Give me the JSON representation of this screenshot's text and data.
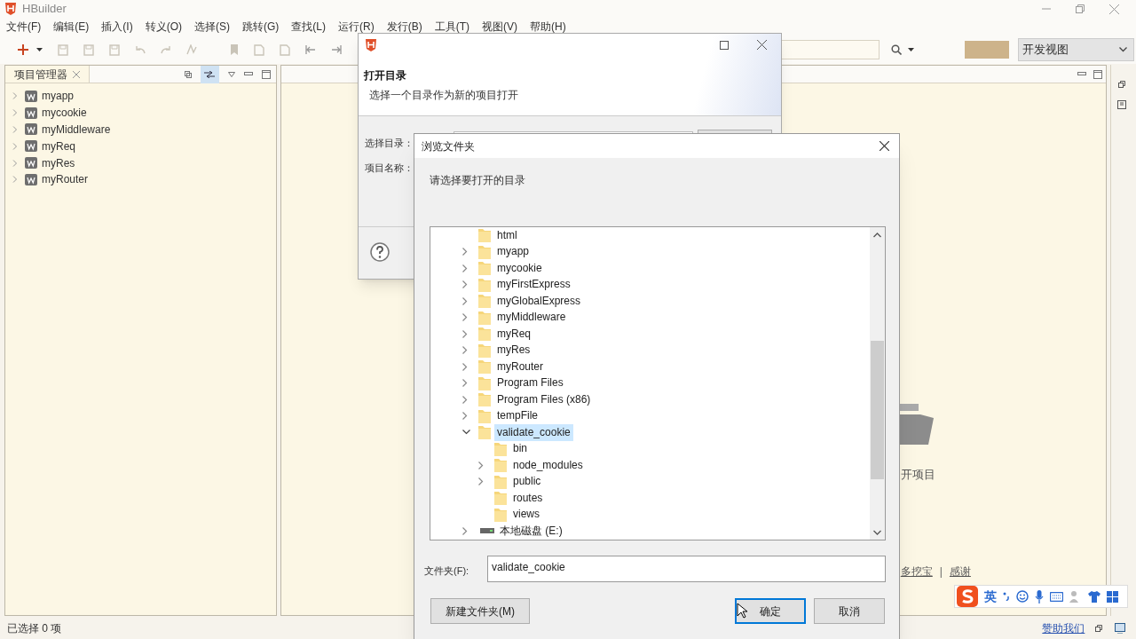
{
  "app": {
    "title": "HBuilder"
  },
  "menu": [
    "文件(F)",
    "编辑(E)",
    "插入(I)",
    "转义(O)",
    "选择(S)",
    "跳转(G)",
    "查找(L)",
    "运行(R)",
    "发行(B)",
    "工具(T)",
    "视图(V)",
    "帮助(H)"
  ],
  "view_select": {
    "value": "开发视图"
  },
  "project_panel": {
    "tab": "项目管理器",
    "items": [
      {
        "label": "myapp",
        "expanded": false
      },
      {
        "label": "mycookie",
        "expanded": false
      },
      {
        "label": "myMiddleware",
        "expanded": false
      },
      {
        "label": "myReq",
        "expanded": false
      },
      {
        "label": "myRes",
        "expanded": false
      },
      {
        "label": "myRouter",
        "expanded": false
      }
    ]
  },
  "editor": {
    "open_project_label": "开项目",
    "links": [
      "多挖宝",
      "感谢"
    ],
    "link_separator": "|"
  },
  "open_dialog": {
    "heading": "打开目录",
    "description": "选择一个目录作为新的项目打开",
    "fields": [
      "选择目录：",
      "项目名称："
    ]
  },
  "browse_dialog": {
    "title": "浏览文件夹",
    "prompt": "请选择要打开的目录",
    "tree": [
      {
        "label": "html",
        "kind": "folder",
        "expandable": false,
        "expanded": false,
        "selected": false
      },
      {
        "label": "myapp",
        "kind": "folder",
        "expandable": true,
        "expanded": false,
        "selected": false
      },
      {
        "label": "mycookie",
        "kind": "folder",
        "expandable": true,
        "expanded": false,
        "selected": false
      },
      {
        "label": "myFirstExpress",
        "kind": "folder",
        "expandable": true,
        "expanded": false,
        "selected": false
      },
      {
        "label": "myGlobalExpress",
        "kind": "folder",
        "expandable": true,
        "expanded": false,
        "selected": false
      },
      {
        "label": "myMiddleware",
        "kind": "folder",
        "expandable": true,
        "expanded": false,
        "selected": false
      },
      {
        "label": "myReq",
        "kind": "folder",
        "expandable": true,
        "expanded": false,
        "selected": false
      },
      {
        "label": "myRes",
        "kind": "folder",
        "expandable": true,
        "expanded": false,
        "selected": false
      },
      {
        "label": "myRouter",
        "kind": "folder",
        "expandable": true,
        "expanded": false,
        "selected": false
      },
      {
        "label": "Program Files",
        "kind": "folder",
        "expandable": true,
        "expanded": false,
        "selected": false
      },
      {
        "label": "Program Files (x86)",
        "kind": "folder",
        "expandable": true,
        "expanded": false,
        "selected": false
      },
      {
        "label": "tempFile",
        "kind": "folder",
        "expandable": true,
        "expanded": false,
        "selected": false
      },
      {
        "label": "validate_cookie",
        "kind": "folder",
        "expandable": true,
        "expanded": true,
        "selected": true,
        "children": [
          {
            "label": "bin",
            "kind": "folder",
            "expandable": false,
            "expanded": false,
            "selected": false
          },
          {
            "label": "node_modules",
            "kind": "folder",
            "expandable": true,
            "expanded": false,
            "selected": false
          },
          {
            "label": "public",
            "kind": "folder",
            "expandable": true,
            "expanded": false,
            "selected": false
          },
          {
            "label": "routes",
            "kind": "folder",
            "expandable": false,
            "expanded": false,
            "selected": false
          },
          {
            "label": "views",
            "kind": "folder",
            "expandable": false,
            "expanded": false,
            "selected": false
          }
        ]
      },
      {
        "label": "本地磁盘 (E:)",
        "kind": "drive",
        "expandable": true,
        "expanded": false,
        "selected": false
      }
    ],
    "folder_label": "文件夹(F):",
    "folder_value": "validate_cookie",
    "buttons": [
      {
        "label": "新建文件夹(M)",
        "focused": false
      },
      {
        "label": "确定",
        "focused": true
      },
      {
        "label": "取消",
        "focused": false
      }
    ]
  },
  "ime_bar": {
    "mode": "英"
  },
  "status_bar": {
    "text": "已选择 0 项",
    "sponsor_link": "赞助我们"
  }
}
